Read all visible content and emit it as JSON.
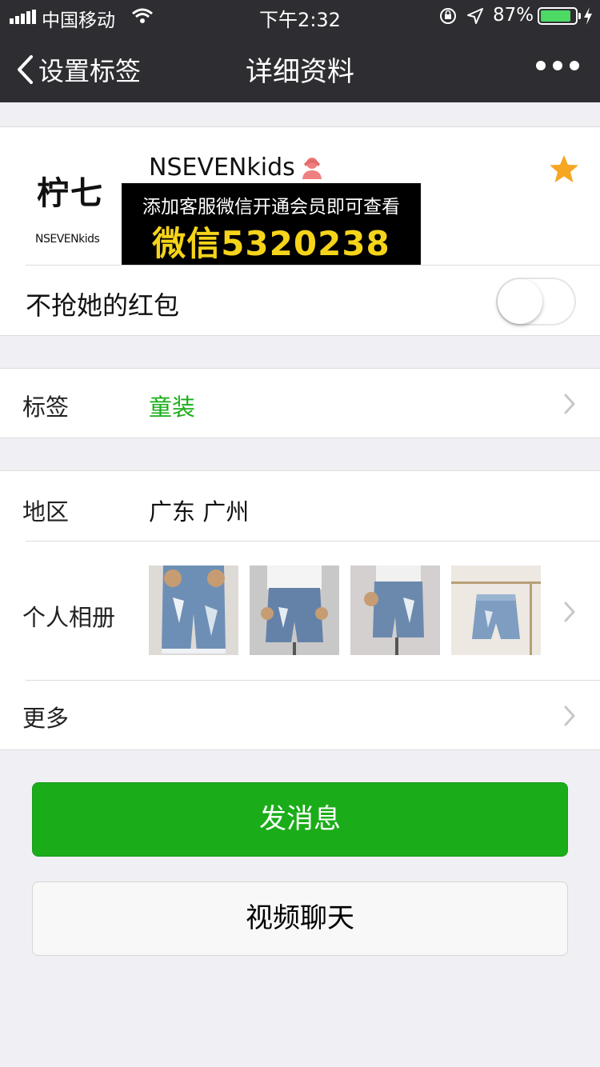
{
  "status_bar": {
    "carrier": "中国移动",
    "time": "下午2:32",
    "battery": "87%",
    "battery_level": 0.87
  },
  "nav": {
    "back_label": "设置标签",
    "title": "详细资料",
    "more_icon": "more-dots-icon"
  },
  "profile": {
    "avatar_logo_big": "柠七",
    "avatar_logo_small": "NSEVENkids",
    "nickname": "NSEVENkids",
    "gender_icon": "female-person-icon",
    "starred": true,
    "promo_line1": "添加客服微信开通会员即可查看",
    "promo_line2": "微信5320238",
    "redpacket_label": "不抢她的红包",
    "redpacket_toggle_on": false
  },
  "tag_row": {
    "label": "标签",
    "value": "童装"
  },
  "region_row": {
    "label": "地区",
    "value": "广东 广州"
  },
  "album_row": {
    "label": "个人相册",
    "photo_count": 4
  },
  "more_row": {
    "label": "更多"
  },
  "buttons": {
    "send_message": "发消息",
    "video_chat": "视频聊天"
  },
  "colors": {
    "nav_bg": "#2e2e32",
    "accent_green": "#1aad19",
    "star": "#f5a623",
    "promo_yellow": "#f5d41a"
  }
}
